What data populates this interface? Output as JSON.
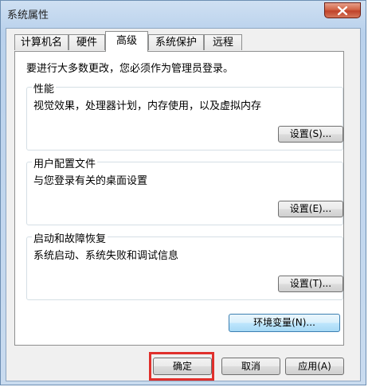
{
  "window": {
    "title": "系统属性"
  },
  "tabs": [
    {
      "label": "计算机名",
      "active": false
    },
    {
      "label": "硬件",
      "active": false
    },
    {
      "label": "高级",
      "active": true
    },
    {
      "label": "系统保护",
      "active": false
    },
    {
      "label": "远程",
      "active": false
    }
  ],
  "panel": {
    "admin_note": "要进行大多数更改，您必须作为管理员登录。",
    "performance": {
      "title": "性能",
      "desc": "视觉效果，处理器计划，内存使用，以及虚拟内存",
      "button": "设置(S)..."
    },
    "user_profiles": {
      "title": "用户配置文件",
      "desc": "与您登录有关的桌面设置",
      "button": "设置(E)..."
    },
    "startup_recovery": {
      "title": "启动和故障恢复",
      "desc": "系统启动、系统失败和调试信息",
      "button": "设置(T)..."
    },
    "env_button": "环境变量(N)..."
  },
  "footer": {
    "ok": "确定",
    "cancel": "取消",
    "apply": "应用(A)"
  },
  "colors": {
    "highlight": "#e0302c",
    "close_button": "#c0432a",
    "accent_button_border": "#3c7fb1"
  }
}
